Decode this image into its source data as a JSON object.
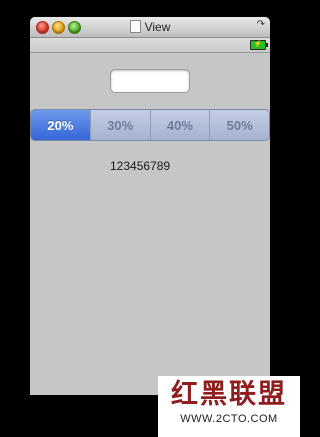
{
  "window": {
    "title": "View"
  },
  "statusbar": {
    "battery_icon": "battery-charging-icon"
  },
  "content": {
    "text_field": {
      "value": "",
      "placeholder": ""
    },
    "segmented_control": {
      "segments": [
        {
          "label": "20%",
          "selected": true
        },
        {
          "label": "30%",
          "selected": false
        },
        {
          "label": "40%",
          "selected": false
        },
        {
          "label": "50%",
          "selected": false
        }
      ],
      "selected_color": "#3a6fdd",
      "unselected_color": "#b0bcd8"
    },
    "value_label": "123456789"
  },
  "watermark": {
    "title": "红黑联盟",
    "url": "WWW.2CTO.COM",
    "color": "#8f1f1f"
  }
}
